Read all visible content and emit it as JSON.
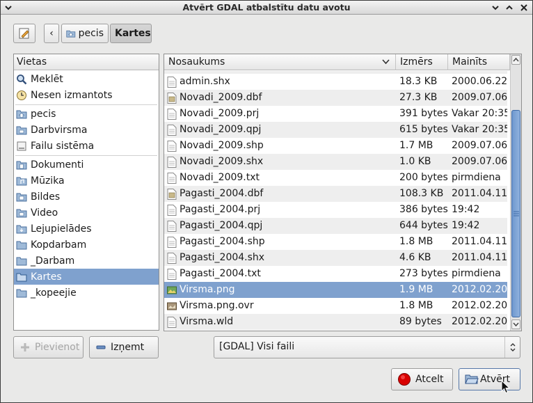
{
  "window": {
    "title": "Atvērt GDAL atbalstītu datu avotu"
  },
  "path_bar": {
    "back_label": "‹",
    "segments": [
      "pecis",
      "Kartes"
    ]
  },
  "places": {
    "header": "Vietas",
    "items": [
      {
        "label": "Meklēt",
        "icon": "search-icon"
      },
      {
        "label": "Nesen izmantots",
        "icon": "clock-icon"
      },
      {
        "label": "pecis",
        "icon": "home-folder-icon"
      },
      {
        "label": "Darbvirsma",
        "icon": "folder-icon"
      },
      {
        "label": "Failu sistēma",
        "icon": "drive-icon"
      },
      {
        "label": "Dokumenti",
        "icon": "folder-icon"
      },
      {
        "label": "Mūzika",
        "icon": "folder-icon"
      },
      {
        "label": "Bildes",
        "icon": "folder-icon"
      },
      {
        "label": "Video",
        "icon": "folder-icon"
      },
      {
        "label": "Lejupielādes",
        "icon": "folder-icon"
      },
      {
        "label": "Kopdarbam",
        "icon": "folder-icon"
      },
      {
        "label": "_Darbam",
        "icon": "folder-icon"
      },
      {
        "label": "Kartes",
        "icon": "folder-icon"
      },
      {
        "label": "_kopeejie",
        "icon": "folder-icon"
      }
    ]
  },
  "files": {
    "columns": {
      "name": "Nosaukums",
      "size": "Izmērs",
      "modified": "Mainīts"
    },
    "rows": [
      {
        "name": "admin.shx",
        "size": "18.3 KB",
        "modified": "2000.06.22.",
        "icon": "file-icon"
      },
      {
        "name": "Novadi_2009.dbf",
        "size": "27.3 KB",
        "modified": "2009.07.06.",
        "icon": "database-file-icon"
      },
      {
        "name": "Novadi_2009.prj",
        "size": "391 bytes",
        "modified": "Vakar 20:35",
        "icon": "file-icon"
      },
      {
        "name": "Novadi_2009.qpj",
        "size": "615 bytes",
        "modified": "Vakar 20:35",
        "icon": "file-icon"
      },
      {
        "name": "Novadi_2009.shp",
        "size": "1.7 MB",
        "modified": "2009.07.06.",
        "icon": "file-icon"
      },
      {
        "name": "Novadi_2009.shx",
        "size": "1.0 KB",
        "modified": "2009.07.06.",
        "icon": "file-icon"
      },
      {
        "name": "Novadi_2009.txt",
        "size": "200 bytes",
        "modified": "pirmdiena",
        "icon": "file-icon"
      },
      {
        "name": "Pagasti_2004.dbf",
        "size": "108.3 KB",
        "modified": "2011.04.11.",
        "icon": "database-file-icon"
      },
      {
        "name": "Pagasti_2004.prj",
        "size": "386 bytes",
        "modified": "19:42",
        "icon": "file-icon"
      },
      {
        "name": "Pagasti_2004.qpj",
        "size": "644 bytes",
        "modified": "19:42",
        "icon": "file-icon"
      },
      {
        "name": "Pagasti_2004.shp",
        "size": "1.8 MB",
        "modified": "2011.04.11.",
        "icon": "file-icon"
      },
      {
        "name": "Pagasti_2004.shx",
        "size": "4.6 KB",
        "modified": "2011.04.11.",
        "icon": "file-icon"
      },
      {
        "name": "Pagasti_2004.txt",
        "size": "273 bytes",
        "modified": "pirmdiena",
        "icon": "file-icon"
      },
      {
        "name": "Virsma.png",
        "size": "1.9 MB",
        "modified": "2012.02.20.",
        "icon": "image-icon"
      },
      {
        "name": "Virsma.png.ovr",
        "size": "1.8 MB",
        "modified": "2012.02.20.",
        "icon": "image-file-icon"
      },
      {
        "name": "Virsma.wld",
        "size": "89 bytes",
        "modified": "2012.02.20.",
        "icon": "file-icon"
      }
    ]
  },
  "buttons": {
    "add": "Pievienot",
    "remove": "Izņemt",
    "cancel": "Atcelt",
    "open": "Atvērt"
  },
  "filter": {
    "selected": "[GDAL] Visi faili"
  },
  "colors": {
    "selection": "#7fa1ce",
    "cancel_icon": "#d90000"
  }
}
